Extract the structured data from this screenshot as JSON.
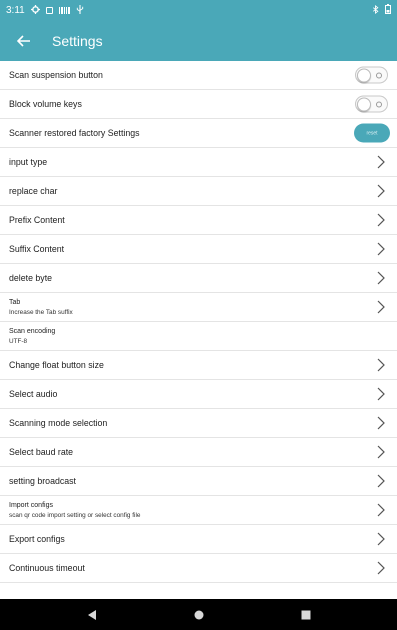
{
  "status_bar": {
    "time": "3:11"
  },
  "app_bar": {
    "title": "Settings"
  },
  "settings": [
    {
      "title": "Scan suspension button",
      "control": "toggle",
      "on": false
    },
    {
      "title": "Block volume keys",
      "control": "toggle",
      "on": false
    },
    {
      "title": "Scanner restored factory Settings",
      "control": "button",
      "button_label": "reset"
    },
    {
      "title": "input type",
      "control": "chevron"
    },
    {
      "title": "replace char",
      "control": "chevron"
    },
    {
      "title": "Prefix Content",
      "control": "chevron"
    },
    {
      "title": "Suffix Content",
      "control": "chevron"
    },
    {
      "title": "delete byte",
      "control": "chevron"
    },
    {
      "title": "Tab",
      "subtitle": "Increase the Tab suffix",
      "control": "chevron"
    },
    {
      "title": "Scan encoding",
      "subtitle": "UTF-8",
      "control": "none"
    },
    {
      "title": "Change float button size",
      "control": "chevron"
    },
    {
      "title": "Select audio",
      "control": "chevron"
    },
    {
      "title": "Scanning mode selection",
      "control": "chevron"
    },
    {
      "title": "Select baud rate",
      "control": "chevron"
    },
    {
      "title": "setting broadcast",
      "control": "chevron"
    },
    {
      "title": "Import configs",
      "subtitle": "scan qr code import setting or select config file",
      "control": "chevron"
    },
    {
      "title": "Export configs",
      "control": "chevron"
    },
    {
      "title": "Continuous timeout",
      "control": "chevron"
    }
  ],
  "colors": {
    "accent": "#4aa8b8",
    "nav_bar": "#000000"
  }
}
